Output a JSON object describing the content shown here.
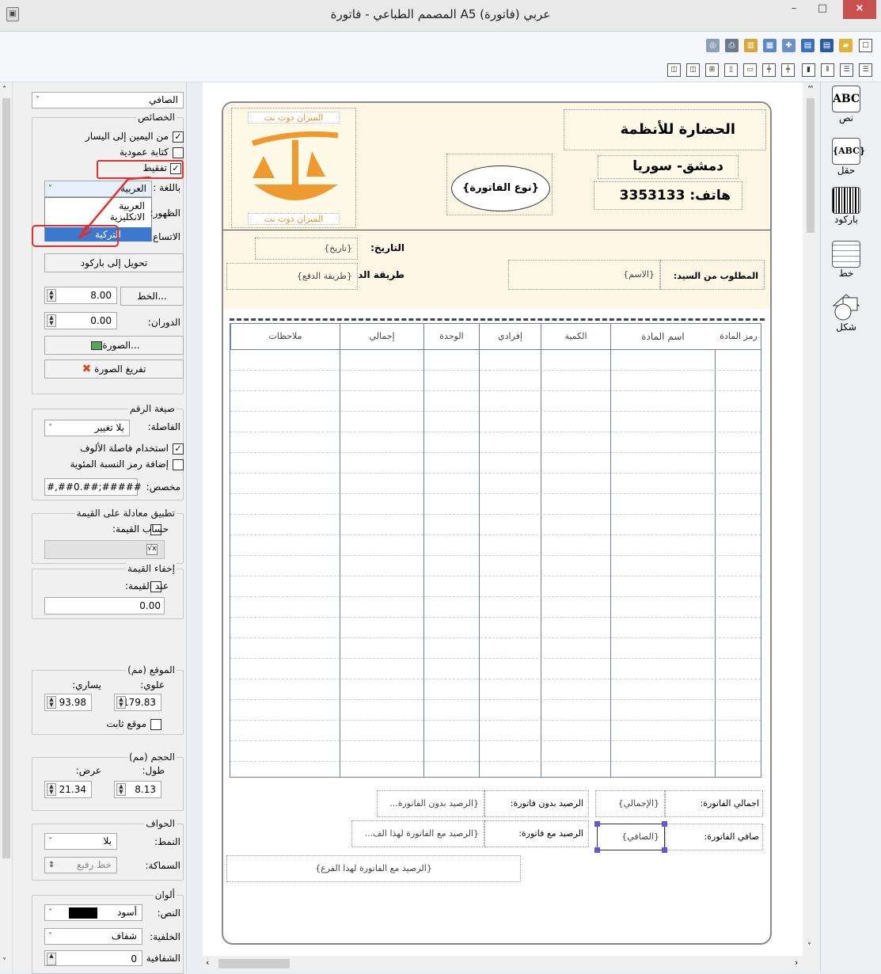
{
  "window": {
    "title": "المصمم الطباعي - فاتورة A5 عربي (فاتورة)",
    "close": "×",
    "max": "□",
    "min": "–"
  },
  "left_panel": {
    "object_combo": "الصافي",
    "props": {
      "title": "الخصائص",
      "rtl": "من اليمين إلى اليسار",
      "vertical": "كتابة عمودية",
      "tafqeet": "تفقيط",
      "lang_label": "باللغة :",
      "lang_value": "العربية",
      "appearance_label": "الظهور:",
      "expand_label": "الاتساع",
      "dropdown_options": [
        "العربية",
        "الانكليزية",
        "التركية"
      ],
      "barcode_btn": "تحويل إلى باركود",
      "font_btn": "الخط...",
      "font_size": "8.00",
      "rotation_label": "الدوران:",
      "rotation": "0.00",
      "image_btn": "الصورة...",
      "clear_image_btn": "تفريغ الصورة"
    },
    "number_format": {
      "title": "صيغة الرقم",
      "sep_label": "الفاصلة:",
      "sep_value": "بلا تغيير",
      "thousands": "استخدام فاصلة الألوف",
      "percent": "إضافة رمز النسبة المئوية",
      "custom_label": "مخصص:",
      "custom_value": "#,##0.##;#####"
    },
    "equation": {
      "title": "تطبيق معادلة على القيمة",
      "calc": "حساب القيمة:"
    },
    "hide": {
      "title": "إخفاء القيمة",
      "when": "عند القيمة:",
      "value": "0.00"
    },
    "position": {
      "title": "الموقع (مم)",
      "top_label": "علوي:",
      "left_label": "يساري:",
      "top": "179.83",
      "left": "93.98",
      "fixed": "موقع ثابت"
    },
    "size": {
      "title": "الحجم (مم)",
      "height_label": "طول:",
      "width_label": "عرض:",
      "height": "8.13",
      "width": "21.34"
    },
    "borders": {
      "title": "الحواف",
      "style_label": "النمط:",
      "style_value": "بلا",
      "thickness_label": "السماكة:",
      "thickness_value": "خط رفيع"
    },
    "colors": {
      "title": "ألوان",
      "text_label": "النص:",
      "text_value": "أسود",
      "bg_label": "الخلفية:",
      "bg_value": "شفاف",
      "trans_label": "الشفافية",
      "trans_value": "0"
    }
  },
  "tools": {
    "text": "نص",
    "field": "حقل",
    "barcode": "باركود",
    "line": "خط",
    "shape": "شكل",
    "abc": "ABC",
    "abc_field": "{ABC}"
  },
  "invoice": {
    "company": "الحضارة للأنظمة",
    "city": "دمشق- سوريا",
    "phone": "هاتف: 3353133",
    "type": "{نوع الفاتورة}",
    "logo_top": "الميزان دوت نت",
    "logo_bottom": "الميزان دوت نت",
    "date_label": "التاريخ:",
    "date_value": "{تاريخ}",
    "payment_label": "طريقة الدفع:",
    "payment_value": "{طريقة الدفع}",
    "customer_label": "المطلوب من السيد:",
    "customer_value": "{الاسم}",
    "columns": [
      "رمز المادة",
      "اسم المادة",
      "الكمية",
      "إفرادي",
      "الوحدة",
      "إجمالي",
      "ملاحظات"
    ],
    "total_label": "اجمالي الفاتورة:",
    "total_value": "{الإجمالي}",
    "net_label": "صافي الفاتورة:",
    "net_value": "{الصافي}",
    "bal_wo_label": "الرصيد بدون فاتورة:",
    "bal_wo_value": "{الرصيد بدون الفاتورة...",
    "bal_w_label": "الرصيد مع فاتورة:",
    "bal_w_value": "{الرصيد مع الفاتورة لهذا الف...",
    "branch_value": "{الرصيد مع الفاتورة لهذا الفرع}"
  }
}
